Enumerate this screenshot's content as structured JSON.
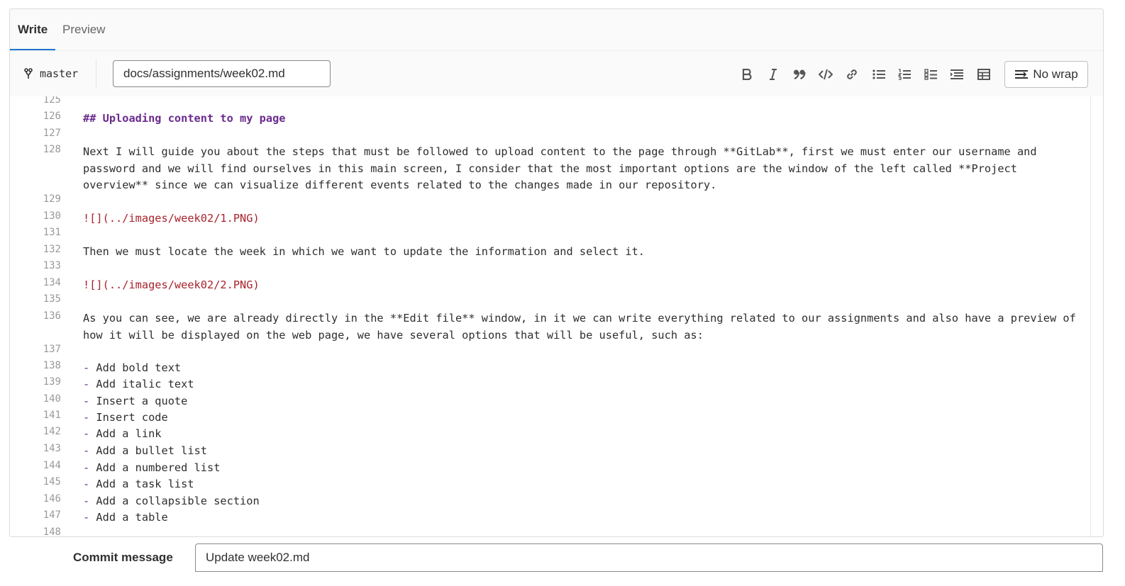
{
  "tabs": [
    {
      "label": "Write",
      "active": true
    },
    {
      "label": "Preview",
      "active": false
    }
  ],
  "toolbar": {
    "branch": "master",
    "file_path": "docs/assignments/week02.md",
    "nowrap_label": "No wrap",
    "format_buttons": [
      "bold",
      "italic",
      "quote",
      "code",
      "link",
      "bullet-list",
      "numbered-list",
      "task-list",
      "collapsible",
      "table"
    ]
  },
  "code": {
    "lines": [
      {
        "n": "125",
        "t": "",
        "style": "plain"
      },
      {
        "n": "126",
        "t": "## Uploading content to my page",
        "style": "heading"
      },
      {
        "n": "127",
        "t": "",
        "style": "plain"
      },
      {
        "n": "128",
        "t": "Next I will guide you about the steps that must be followed to upload content to the page through **GitLab**, first we must enter our username and password and we will find ourselves in this main screen, I consider that the most important options are the window of the left called **Project overview** since we can visualize different events related to the changes made in our repository.",
        "style": "plain"
      },
      {
        "n": "129",
        "t": "",
        "style": "plain"
      },
      {
        "n": "130",
        "t": "![](../images/week02/1.PNG)",
        "style": "link"
      },
      {
        "n": "131",
        "t": "",
        "style": "plain"
      },
      {
        "n": "132",
        "t": "Then we must locate the week in which we want to update the information and select it.",
        "style": "plain"
      },
      {
        "n": "133",
        "t": "",
        "style": "plain"
      },
      {
        "n": "134",
        "t": "![](../images/week02/2.PNG)",
        "style": "link"
      },
      {
        "n": "135",
        "t": "",
        "style": "plain"
      },
      {
        "n": "136",
        "t": "As you can see, we are already directly in the **Edit file** window, in it we can write everything related to our assignments and also have a preview of how it will be displayed on the web page, we have several options that will be useful, such as:",
        "style": "plain"
      },
      {
        "n": "137",
        "t": "",
        "style": "plain"
      },
      {
        "n": "138",
        "t": "Add bold text",
        "style": "bullet"
      },
      {
        "n": "139",
        "t": "Add italic text",
        "style": "bullet"
      },
      {
        "n": "140",
        "t": "Insert a quote",
        "style": "bullet"
      },
      {
        "n": "141",
        "t": "Insert code",
        "style": "bullet"
      },
      {
        "n": "142",
        "t": "Add a link",
        "style": "bullet"
      },
      {
        "n": "143",
        "t": "Add a bullet list",
        "style": "bullet"
      },
      {
        "n": "144",
        "t": "Add a numbered list",
        "style": "bullet"
      },
      {
        "n": "145",
        "t": "Add a task list",
        "style": "bullet"
      },
      {
        "n": "146",
        "t": "Add a collapsible section",
        "style": "bullet"
      },
      {
        "n": "147",
        "t": "Add a table",
        "style": "bullet"
      },
      {
        "n": "148",
        "t": "",
        "style": "plain"
      }
    ]
  },
  "commit": {
    "label": "Commit message",
    "value": "Update week02.md"
  },
  "colors": {
    "accent": "#1f75cb",
    "heading": "#6b2b8e",
    "link": "#a8222c",
    "line_number": "#999999"
  }
}
